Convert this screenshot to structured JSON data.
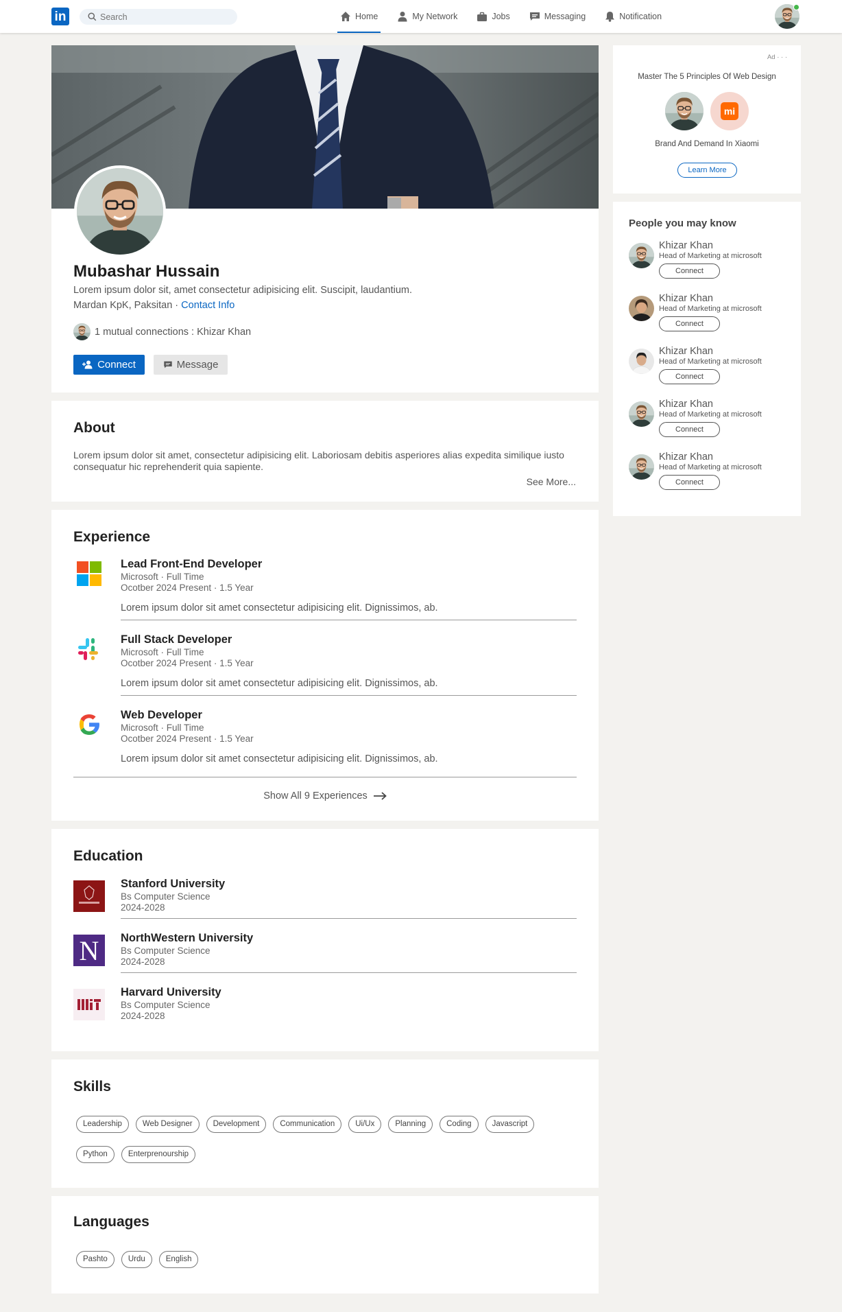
{
  "nav": {
    "logo": "in",
    "search_placeholder": "Search",
    "items": [
      {
        "label": "Home",
        "icon": "home-icon"
      },
      {
        "label": "My Network",
        "icon": "network-icon"
      },
      {
        "label": "Jobs",
        "icon": "briefcase-icon"
      },
      {
        "label": "Messaging",
        "icon": "messaging-icon"
      },
      {
        "label": "Notification",
        "icon": "bell-icon"
      }
    ]
  },
  "profile": {
    "name": "Mubashar Hussain",
    "headline": "Lorem ipsum dolor sit, amet consectetur adipisicing elit. Suscipit, laudantium.",
    "location": "Mardan KpK, Paksitan",
    "separator": " · ",
    "contact_label": "Contact Info",
    "mutual": "1 mutual connections : Khizar Khan",
    "connect_label": "Connect",
    "message_label": "Message"
  },
  "about": {
    "title": "About",
    "text": "Lorem ipsum dolor sit amet, consectetur adipisicing elit. Laboriosam debitis asperiores alias expedita similique iusto consequatur hic reprehenderit quia sapiente.",
    "see_more": "See More..."
  },
  "experience": {
    "title": "Experience",
    "items": [
      {
        "title": "Lead Front-End Developer",
        "company": "Microsoft · Full Time",
        "dates": "Ocotber 2024 Present · 1.5 Year",
        "desc": "Lorem ipsum dolor sit amet consectetur adipisicing elit. Dignissimos, ab.",
        "logo": "microsoft-logo"
      },
      {
        "title": "Full Stack Developer",
        "company": "Microsoft · Full Time",
        "dates": "Ocotber 2024 Present · 1.5 Year",
        "desc": "Lorem ipsum dolor sit amet consectetur adipisicing elit. Dignissimos, ab.",
        "logo": "slack-logo"
      },
      {
        "title": "Web Developer",
        "company": "Microsoft · Full Time",
        "dates": "Ocotber 2024 Present · 1.5 Year",
        "desc": "Lorem ipsum dolor sit amet consectetur adipisicing elit. Dignissimos, ab.",
        "logo": "google-logo"
      }
    ],
    "show_all": "Show All 9 Experiences"
  },
  "education": {
    "title": "Education",
    "items": [
      {
        "school": "Stanford University",
        "degree": "Bs Computer Science",
        "years": "2024-2028",
        "logo": "stanford-logo"
      },
      {
        "school": "NorthWestern University",
        "degree": "Bs Computer Science",
        "years": "2024-2028",
        "logo": "northwestern-logo"
      },
      {
        "school": "Harvard University",
        "degree": "Bs Computer Science",
        "years": "2024-2028",
        "logo": "mit-logo"
      }
    ]
  },
  "skills": {
    "title": "Skills",
    "items": [
      "Leadership",
      "Web Designer",
      "Development",
      "Communication",
      "Ui/Ux",
      "Planning",
      "Coding",
      "Javascript",
      "Python",
      "Enterprenourship"
    ]
  },
  "languages": {
    "title": "Languages",
    "items": [
      "Pashto",
      "Urdu",
      "English"
    ]
  },
  "ad": {
    "label": "Ad · · ·",
    "title": "Master The 5 Principles Of Web Design",
    "subtitle": "Brand And Demand In Xiaomi",
    "button": "Learn More",
    "brand_text": "mi"
  },
  "pymk": {
    "title": "People you may know",
    "people": [
      {
        "name": "Khizar Khan",
        "title": "Head of Marketing at microsoft",
        "button": "Connect"
      },
      {
        "name": "Khizar Khan",
        "title": "Head of Marketing at microsoft",
        "button": "Connect"
      },
      {
        "name": "Khizar Khan",
        "title": "Head of Marketing at microsoft",
        "button": "Connect"
      },
      {
        "name": "Khizar Khan",
        "title": "Head of Marketing at microsoft",
        "button": "Connect"
      },
      {
        "name": "Khizar Khan",
        "title": "Head of Marketing at microsoft",
        "button": "Connect"
      }
    ]
  },
  "colors": {
    "accent": "#0a66c2",
    "background": "#f3f2ef",
    "online": "#44b74a"
  }
}
